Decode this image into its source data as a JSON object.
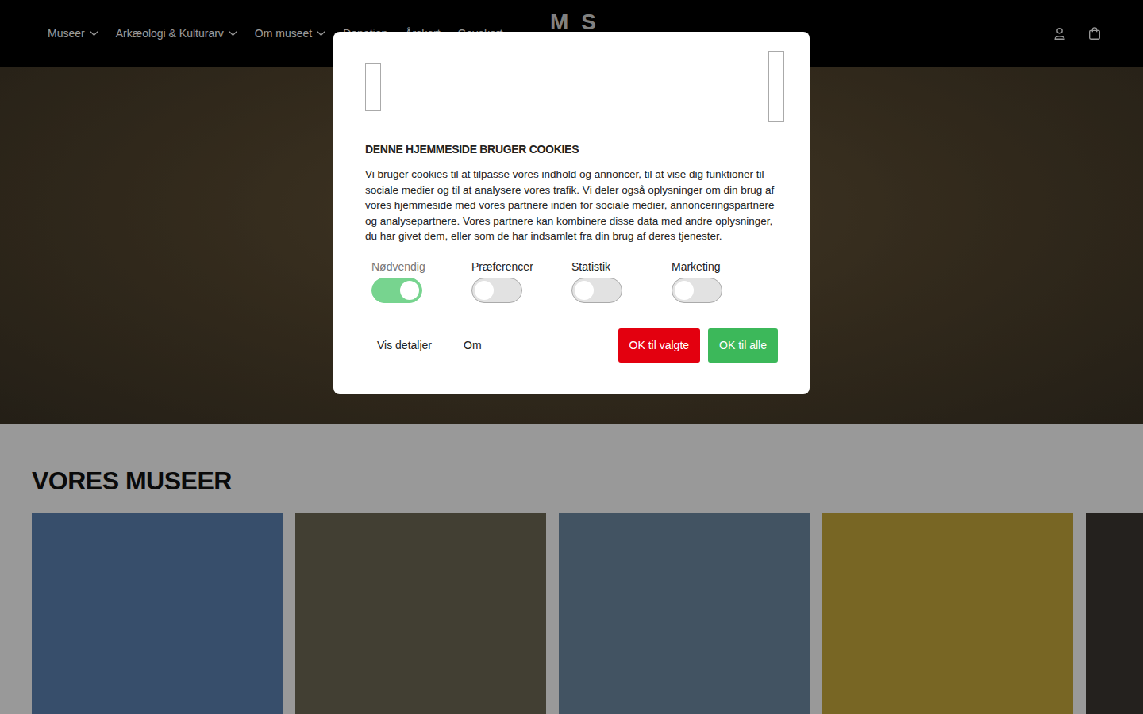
{
  "header": {
    "nav": [
      {
        "label": "Museer",
        "dropdown": true
      },
      {
        "label": "Arkæologi & Kulturarv",
        "dropdown": true
      },
      {
        "label": "Om museet",
        "dropdown": true
      },
      {
        "label": "Donation",
        "dropdown": false
      },
      {
        "label": "Årskort",
        "dropdown": false
      },
      {
        "label": "Gavekort",
        "dropdown": false
      }
    ],
    "logo": "M S"
  },
  "section": {
    "title": "VORES MUSEER",
    "cards": [
      {
        "color": "#5d82b2"
      },
      {
        "color": "#6e6a55"
      },
      {
        "color": "#6f8ba3"
      },
      {
        "color": "#c9aa3c"
      },
      {
        "color": "#3d3733"
      }
    ]
  },
  "cookie": {
    "title": "DENNE HJEMMESIDE BRUGER COOKIES",
    "text": "Vi bruger cookies til at tilpasse vores indhold og annoncer, til at vise dig funktioner til sociale medier og til at analysere vores trafik. Vi deler også oplysninger om din brug af vores hjemmeside med vores partnere inden for sociale medier, annonceringspartnere og analysepartnere. Vores partnere kan kombinere disse data med andre oplysninger, du har givet dem, eller som de har indsamlet fra din brug af deres tjenester.",
    "toggles": [
      {
        "label": "Nødvendig",
        "on": true,
        "disabled": true
      },
      {
        "label": "Præferencer",
        "on": false,
        "disabled": false
      },
      {
        "label": "Statistik",
        "on": false,
        "disabled": false
      },
      {
        "label": "Marketing",
        "on": false,
        "disabled": false
      }
    ],
    "links": [
      "Vis detaljer",
      "Om"
    ],
    "buttons": [
      {
        "label": "OK til valgte",
        "color": "#e3000f"
      },
      {
        "label": "OK til alle",
        "color": "#3cb85a"
      }
    ]
  }
}
